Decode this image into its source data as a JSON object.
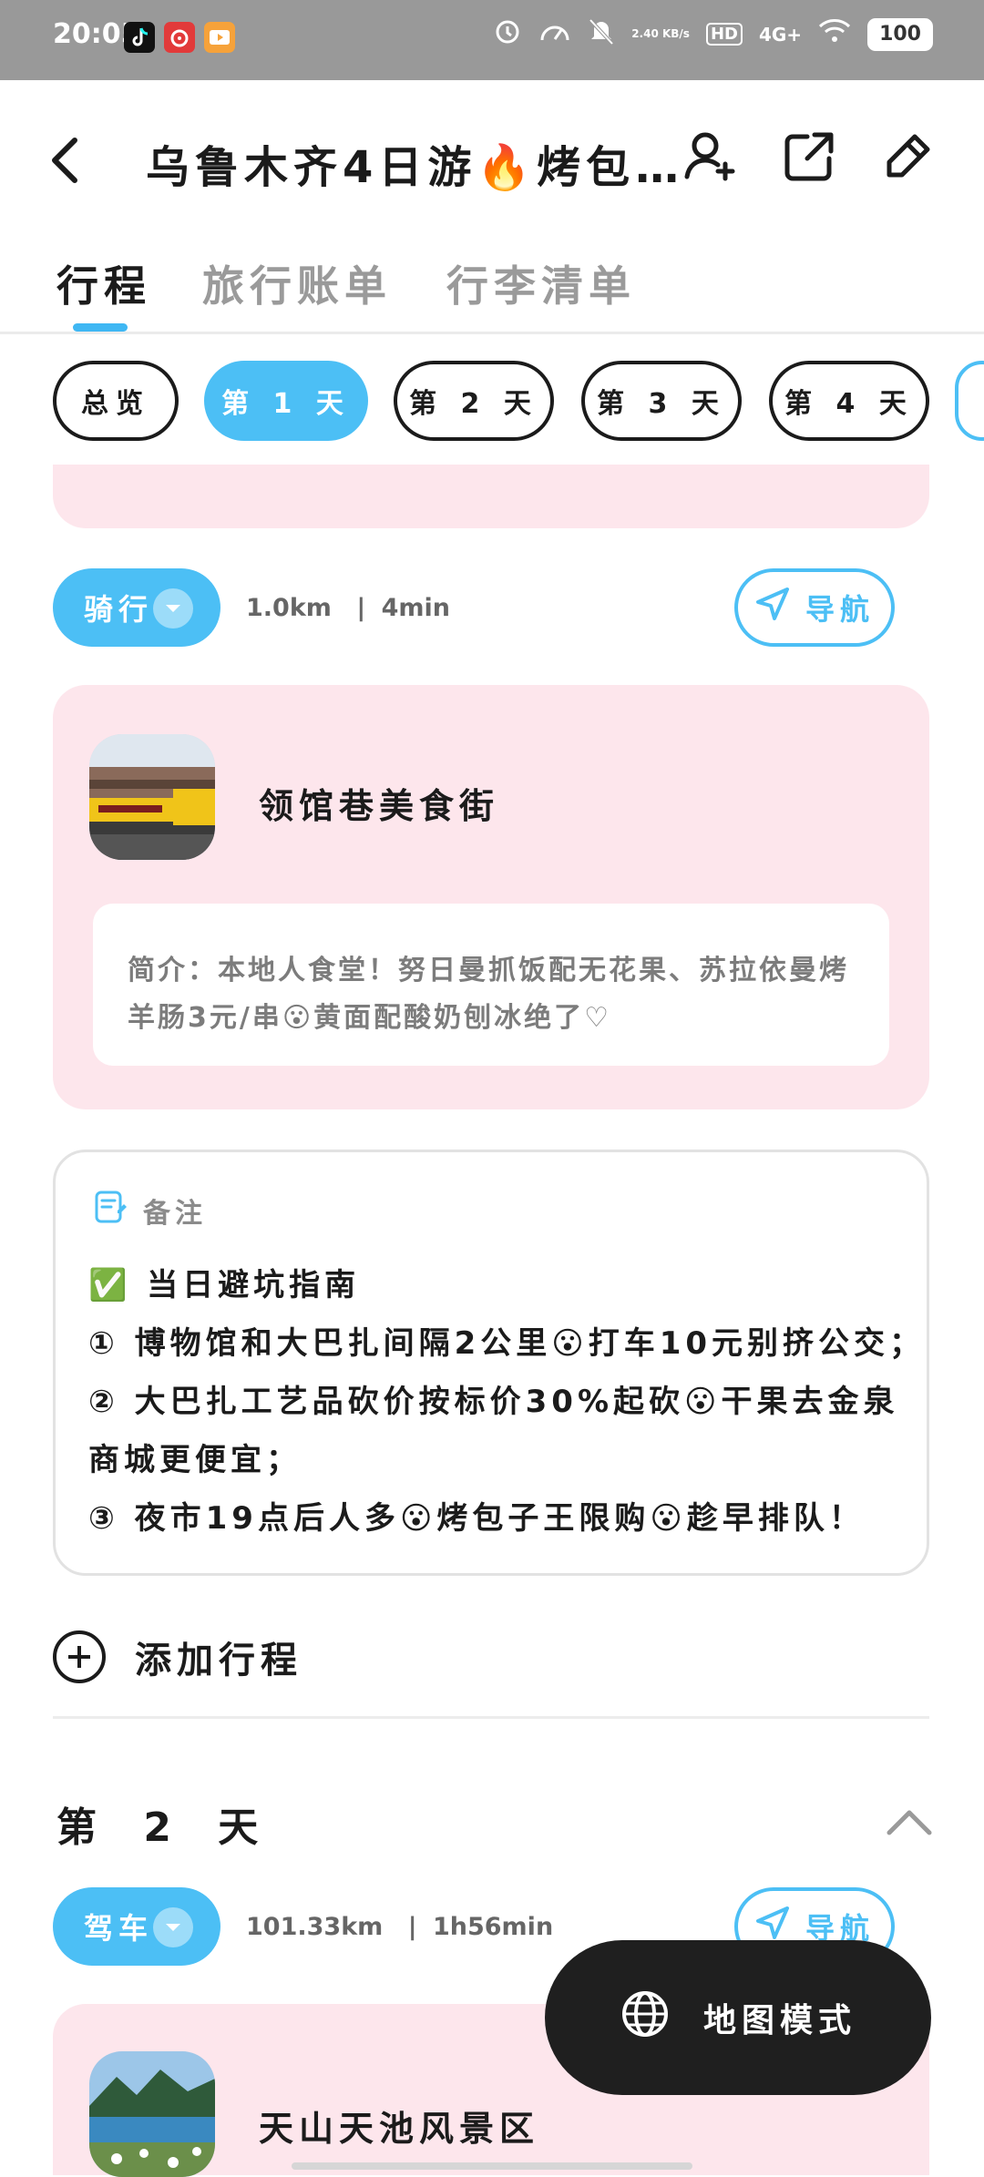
{
  "status_bar": {
    "time": "20:05",
    "net_speed": "2.40 KB/s",
    "hd": "HD",
    "network": "4G+",
    "battery": "100"
  },
  "header": {
    "title": "乌鲁木齐4日游🔥烤包…",
    "icons": [
      "back-icon",
      "add-member-icon",
      "share-icon",
      "edit-icon"
    ]
  },
  "tabs": [
    {
      "label": "行程",
      "active": true
    },
    {
      "label": "旅行账单",
      "active": false
    },
    {
      "label": "行李清单",
      "active": false
    }
  ],
  "day_chips": [
    {
      "label": "总览",
      "selected": false
    },
    {
      "label": "第 1 天",
      "selected": true
    },
    {
      "label": "第 2 天",
      "selected": false
    },
    {
      "label": "第 3 天",
      "selected": false
    },
    {
      "label": "第 4 天",
      "selected": false
    }
  ],
  "segment1": {
    "mode": "骑行",
    "distance": "1.0km",
    "duration": "4min",
    "nav_label": "导航"
  },
  "place1": {
    "name": "领馆巷美食街",
    "intro": "简介：本地人食堂！努日曼抓饭配无花果、苏拉依曼烤羊肠3元/串😮黄面配酸奶刨冰绝了♡"
  },
  "note": {
    "title": "备注",
    "lines": [
      "✅ 当日避坑指南",
      "① 博物馆和大巴扎间隔2公里😮打车10元别挤公交；",
      "② 大巴扎工艺品砍价按标价30%起砍😮干果去金泉",
      "商城更便宜；",
      "③ 夜市19点后人多😮烤包子王限购😮趁早排队！"
    ]
  },
  "add_label": "添加行程",
  "day2": {
    "title": "第 2 天",
    "mode": "驾车",
    "distance": "101.33km",
    "duration": "1h56min",
    "nav_label": "导航",
    "place_name": "天山天池风景区"
  },
  "map_mode_label": "地图模式",
  "colors": {
    "accent": "#4cbff5",
    "card_pink": "#fde6ec",
    "dark": "#1b1b1b"
  }
}
